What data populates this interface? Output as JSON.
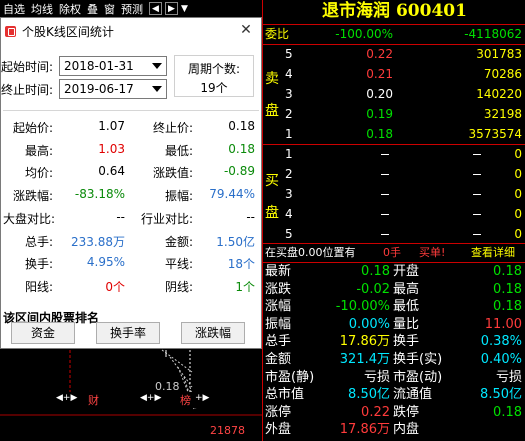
{
  "toolbar": {
    "items": [
      "自选",
      "均线",
      "除权",
      "叠",
      "窗",
      "预测"
    ],
    "nav_left": "◀",
    "nav_right": "▶",
    "nav_down": "▼"
  },
  "stock": {
    "title": "退市海润 600401"
  },
  "order_book": {
    "ratio_label": "委比",
    "ratio_value": "-100.00%",
    "ratio_diff": "-4118062",
    "sell": [
      {
        "label": "5",
        "price": "0.22",
        "vol": "301783",
        "price_color": "red"
      },
      {
        "label": "4",
        "price": "0.21",
        "vol": "70286",
        "price_color": "red"
      },
      {
        "label": "3",
        "price": "0.20",
        "vol": "140220",
        "price_color": "white"
      },
      {
        "label": "2",
        "price": "0.19",
        "vol": "32198",
        "price_color": "green"
      },
      {
        "label": "1",
        "price": "0.18",
        "vol": "3573574",
        "price_color": "green"
      }
    ],
    "buy": [
      {
        "label": "1",
        "vol": "0"
      },
      {
        "label": "2",
        "vol": "0"
      },
      {
        "label": "3",
        "vol": "0"
      },
      {
        "label": "4",
        "vol": "0"
      },
      {
        "label": "5",
        "vol": "0"
      }
    ],
    "sell_side_chars": [
      "卖",
      "盘"
    ],
    "buy_side_chars": [
      "买",
      "盘"
    ],
    "status_left": "在买盘0.00位置有",
    "status_mid": "0手",
    "status_action": "买单!",
    "status_link": "查看详细"
  },
  "quote": [
    {
      "l1": "最新",
      "v1": "0.18",
      "c1": "green",
      "l2": "开盘",
      "v2": "0.18",
      "c2": "green"
    },
    {
      "l1": "涨跌",
      "v1": "-0.02",
      "c1": "green",
      "l2": "最高",
      "v2": "0.18",
      "c2": "green"
    },
    {
      "l1": "涨幅",
      "v1": "-10.00%",
      "c1": "green",
      "l2": "最低",
      "v2": "0.18",
      "c2": "green"
    },
    {
      "l1": "振幅",
      "v1": "0.00%",
      "c1": "cyan",
      "l2": "量比",
      "v2": "11.00",
      "c2": "red"
    },
    {
      "l1": "总手",
      "v1": "17.86万",
      "c1": "yellow",
      "l2": "换手",
      "v2": "0.38%",
      "c2": "cyan"
    },
    {
      "l1": "金额",
      "v1": "321.4万",
      "c1": "cyan",
      "l2": "换手(实)",
      "v2": "0.40%",
      "c2": "cyan"
    },
    {
      "l1": "市盈(静)",
      "v1": "亏损",
      "c1": "white",
      "l2": "市盈(动)",
      "v2": "亏损",
      "c2": "white"
    },
    {
      "l1": "总市值",
      "v1": "8.50亿",
      "c1": "cyan",
      "l2": "流通值",
      "v2": "8.50亿",
      "c2": "cyan"
    },
    {
      "l1": "涨停",
      "v1": "0.22",
      "c1": "red",
      "l2": "跌停",
      "v2": "0.18",
      "c2": "green"
    },
    {
      "l1": "外盘",
      "v1": "17.86万",
      "c1": "red",
      "l2": "内盘",
      "v2": "",
      "c2": "green"
    }
  ],
  "chart_bg": {
    "value_label": "0.18",
    "bottom_left_mark": "财",
    "bottom_right_mark": "榜",
    "bottom_number": "21878"
  },
  "dialog": {
    "title": "个股K线区间统计",
    "start_label": "起始时间:",
    "start_value": "2018-01-31",
    "end_label": "终止时间:",
    "end_value": "2019-06-17",
    "period_label": "周期个数:",
    "period_value": "19个",
    "stats": [
      {
        "l1": "起始价:",
        "v1": "1.07",
        "c1": "black",
        "l2": "终止价:",
        "v2": "0.18",
        "c2": "black"
      },
      {
        "l1": "最高:",
        "v1": "1.03",
        "c1": "dred",
        "l2": "最低:",
        "v2": "0.18",
        "c2": "dgreen"
      },
      {
        "l1": "均价:",
        "v1": "0.64",
        "c1": "black",
        "l2": "涨跌值:",
        "v2": "-0.89",
        "c2": "dgreen"
      },
      {
        "l1": "涨跌幅:",
        "v1": "-83.18%",
        "c1": "dgreen",
        "l2": "振幅:",
        "v2": "79.44%",
        "c2": "blue"
      },
      {
        "l1": "大盘对比:",
        "v1": "--",
        "c1": "black",
        "l2": "行业对比:",
        "v2": "--",
        "c2": "black"
      },
      {
        "l1": "总手:",
        "v1": "233.88万",
        "c1": "blue",
        "l2": "金额:",
        "v2": "1.50亿",
        "c2": "blue"
      },
      {
        "l1": "换手:",
        "v1": "4.95%",
        "c1": "blue",
        "l2": "平线:",
        "v2": "18个",
        "c2": "blue"
      },
      {
        "l1": "阳线:",
        "v1": "0个",
        "c1": "dred",
        "l2": "阴线:",
        "v2": "1个",
        "c2": "dgreen"
      }
    ],
    "rank_label": "该区间内股票排名",
    "buttons": [
      "资金",
      "换手率",
      "涨跌幅"
    ]
  }
}
